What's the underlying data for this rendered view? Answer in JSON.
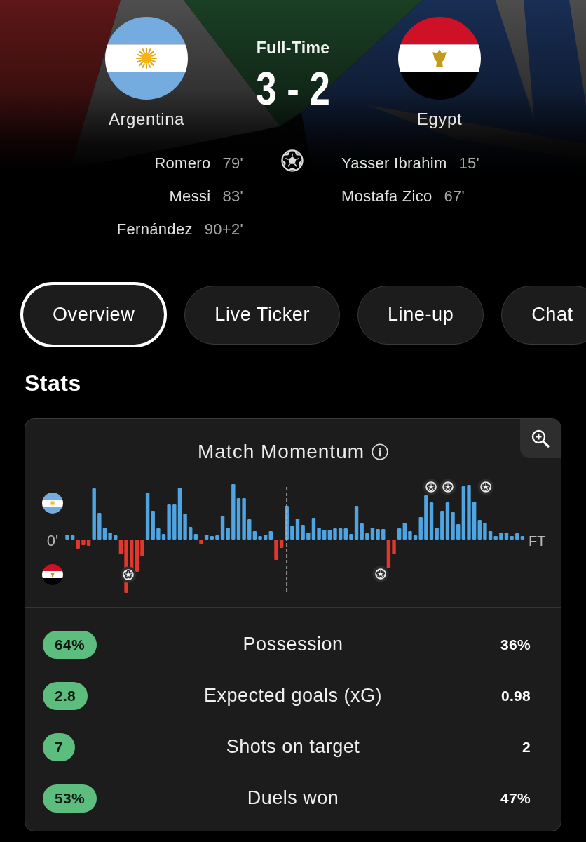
{
  "match": {
    "status": "Full-Time",
    "score": "3 - 2",
    "home": {
      "name": "Argentina"
    },
    "away": {
      "name": "Egypt"
    }
  },
  "goals": {
    "home": [
      {
        "player": "Romero",
        "minute": "79'"
      },
      {
        "player": "Messi",
        "minute": "83'"
      },
      {
        "player": "Fernández",
        "minute": "90+2'"
      }
    ],
    "away": [
      {
        "player": "Yasser Ibrahim",
        "minute": "15'"
      },
      {
        "player": "Mostafa Zico",
        "minute": "67'"
      }
    ]
  },
  "tabs": [
    {
      "label": "Overview",
      "selected": true
    },
    {
      "label": "Live Ticker",
      "selected": false
    },
    {
      "label": "Line-up",
      "selected": false
    },
    {
      "label": "Chat",
      "selected": false
    }
  ],
  "stats": {
    "title": "Stats",
    "momentum": {
      "title": "Match Momentum",
      "start_label": "0'",
      "end_label": "FT"
    },
    "rows": [
      {
        "name": "Possession",
        "home": {
          "value": "64%",
          "highlighted": true
        },
        "away": {
          "value": "36%",
          "highlighted": false
        }
      },
      {
        "name": "Expected goals (xG)",
        "home": {
          "value": "2.8",
          "highlighted": true
        },
        "away": {
          "value": "0.98",
          "highlighted": false
        }
      },
      {
        "name": "Shots on target",
        "home": {
          "value": "7",
          "highlighted": true
        },
        "away": {
          "value": "2",
          "highlighted": false
        }
      },
      {
        "name": "Duels won",
        "home": {
          "value": "53%",
          "highlighted": true
        },
        "away": {
          "value": "47%",
          "highlighted": false
        }
      }
    ]
  }
}
